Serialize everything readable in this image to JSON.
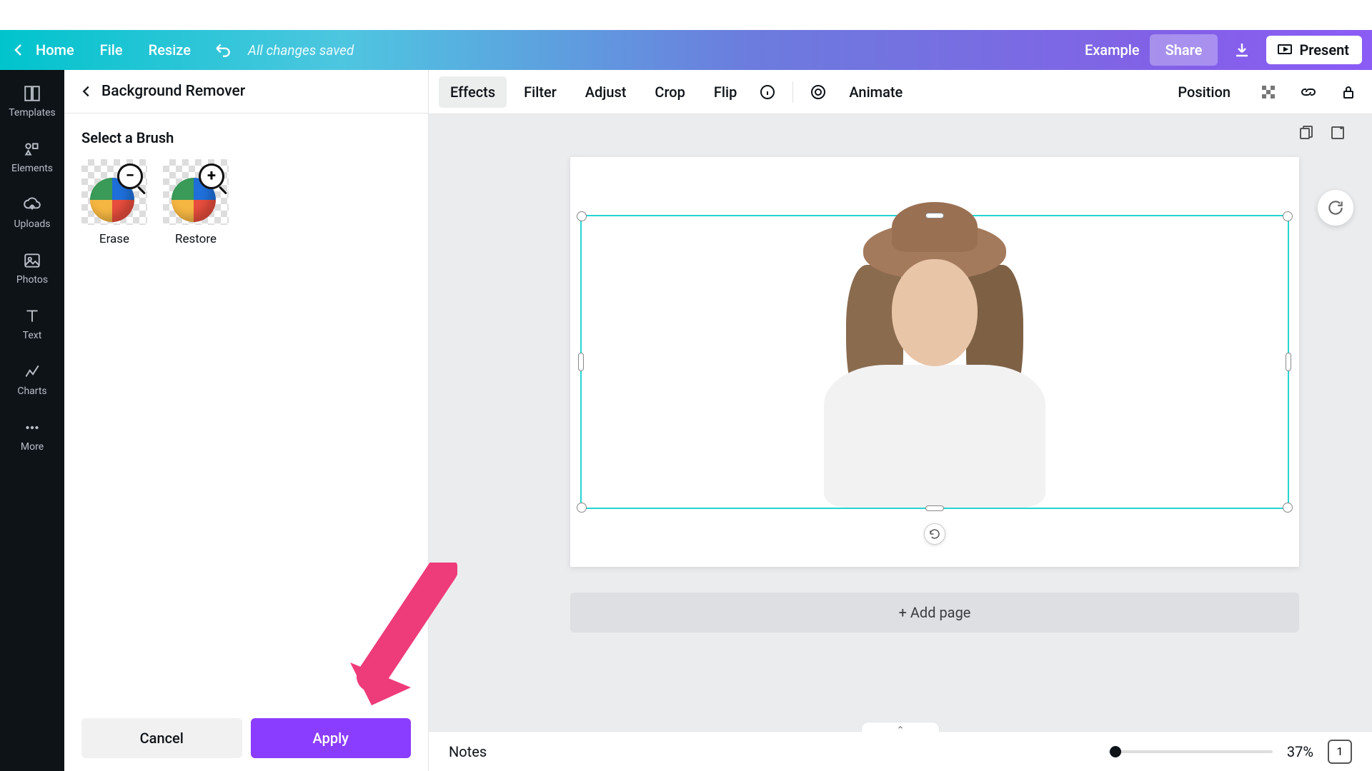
{
  "header": {
    "home": "Home",
    "file": "File",
    "resize": "Resize",
    "save_status": "All changes saved",
    "example": "Example",
    "share": "Share",
    "present": "Present"
  },
  "sidebar": {
    "templates": "Templates",
    "elements": "Elements",
    "uploads": "Uploads",
    "photos": "Photos",
    "text": "Text",
    "charts": "Charts",
    "more": "More"
  },
  "leftPanel": {
    "title": "Background Remover",
    "brushTitle": "Select a Brush",
    "erase": "Erase",
    "restore": "Restore",
    "cancel": "Cancel",
    "apply": "Apply"
  },
  "toolbar": {
    "effects": "Effects",
    "filter": "Filter",
    "adjust": "Adjust",
    "crop": "Crop",
    "flip": "Flip",
    "animate": "Animate",
    "position": "Position"
  },
  "canvas": {
    "addPage": "+ Add page"
  },
  "footer": {
    "notes": "Notes",
    "zoomPct": "37%",
    "pageNum": "1"
  }
}
